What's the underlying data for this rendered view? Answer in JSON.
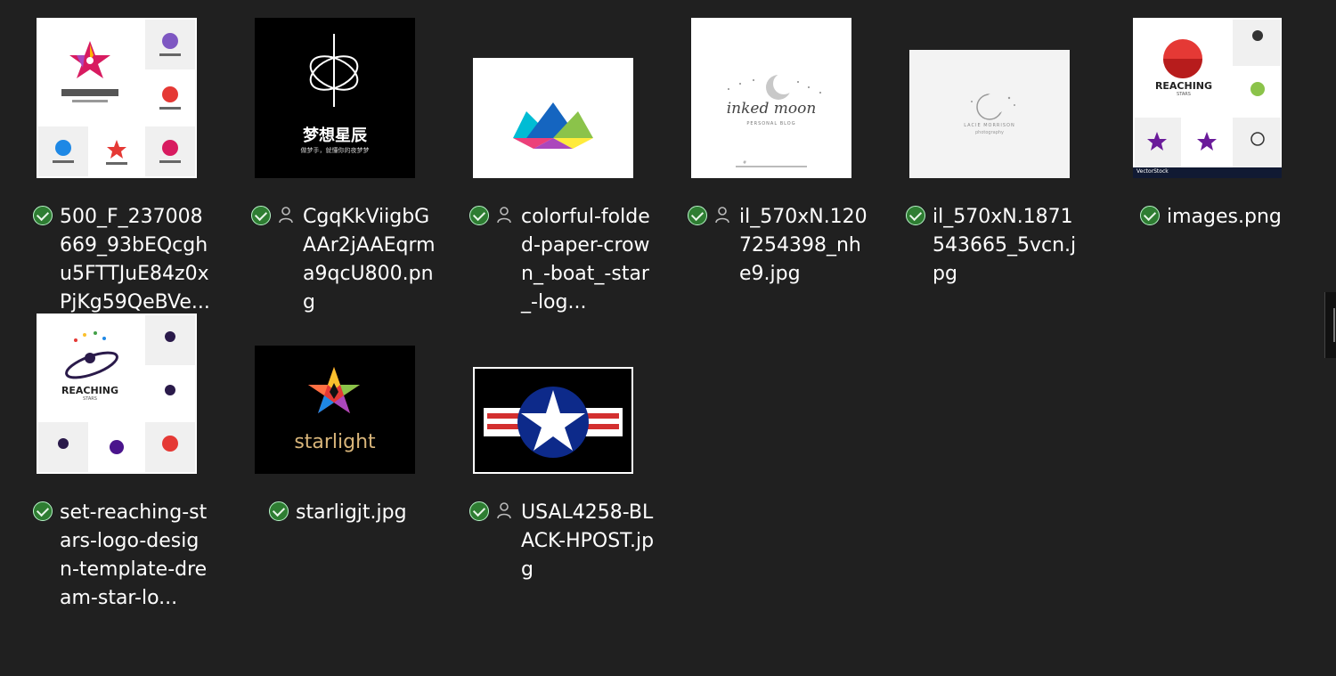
{
  "files": [
    {
      "name": "500_F_237008669_93bEQcghu5FTTJuE84z0xPjKg59QeBVe...",
      "status": "synced-icon",
      "shared": false,
      "thumb": "reaching-stars-sheet"
    },
    {
      "name": "CgqKkViigbGAAr2jAAEqrma9qcU800.png",
      "status": "synced-icon",
      "shared": true,
      "thumb": "dream-stars-logo",
      "thumb_text": "梦想星辰",
      "thumb_subtext": "做梦手，就懂你的夜梦梦"
    },
    {
      "name": "colorful-folded-paper-crown_-boat_-star_-log...",
      "status": "synced-icon",
      "shared": true,
      "thumb": "paper-crown"
    },
    {
      "name": "il_570xN.1207254398_nhe9.jpg",
      "status": "synced-icon",
      "shared": true,
      "thumb": "inked-moon",
      "thumb_text": "inked moon",
      "thumb_subtext": "PERSONAL BLOG",
      "thumb_footer": "#"
    },
    {
      "name": "il_570xN.1871543665_5vcn.jpg",
      "status": "synced-icon",
      "shared": false,
      "thumb": "lacie-moon",
      "thumb_text": "LACIE MORRISON",
      "thumb_subtext": "photography"
    },
    {
      "name": "images.png",
      "status": "synced-icon",
      "shared": false,
      "thumb": "reaching-stars-sheet-2",
      "thumb_text": "REACHING",
      "thumb_subtext": "STARS",
      "thumb_footer": "VectorStock"
    },
    {
      "name": "set-reaching-stars-logo-design-template-dream-star-lo...",
      "status": "synced-icon",
      "shared": false,
      "thumb": "reaching-stars-sheet-3",
      "thumb_text": "REACHING",
      "thumb_subtext": "STARS"
    },
    {
      "name": "starligjt.jpg",
      "status": "synced-icon",
      "shared": false,
      "thumb": "starlight-logo",
      "thumb_text": "starlight"
    },
    {
      "name": "USAL4258-BLACK-HPOST.jpg",
      "status": "synced-icon",
      "shared": true,
      "thumb": "roundel-star"
    }
  ]
}
